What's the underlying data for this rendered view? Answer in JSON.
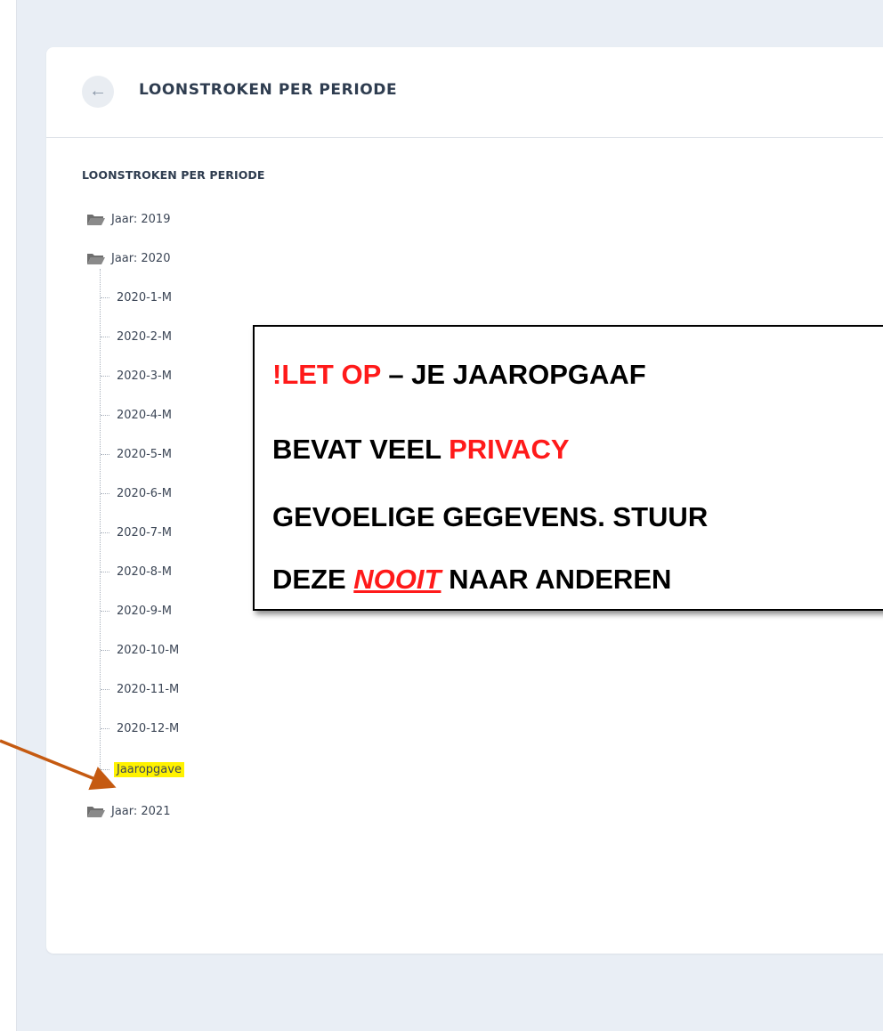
{
  "header": {
    "back_icon": "arrow-left-icon",
    "title": "LOONSTROKEN PER PERIODE"
  },
  "tree": {
    "label": "LOONSTROKEN PER PERIODE",
    "folders": [
      {
        "label": "Jaar: 2019",
        "icon": "folder-open-icon"
      },
      {
        "label": "Jaar: 2020",
        "icon": "folder-open-icon"
      },
      {
        "label": "Jaar: 2021",
        "icon": "folder-open-icon"
      }
    ],
    "items_2020": [
      "2020-1-M",
      "2020-2-M",
      "2020-3-M",
      "2020-4-M",
      "2020-5-M",
      "2020-6-M",
      "2020-7-M",
      "2020-8-M",
      "2020-9-M",
      "2020-10-M",
      "2020-11-M",
      "2020-12-M",
      "Jaaropgave"
    ],
    "highlight_color": "#fff200"
  },
  "notice": {
    "line1_red": "!LET OP",
    "line1_rest": " – JE JAAROPGAAF",
    "line2_start": "BEVAT VEEL ",
    "line2_red": "PRIVACY",
    "line3": "GEVOELIGE GEGEVENS. STUUR",
    "line4_start": "DEZE ",
    "line4_red": "NOOIT",
    "line4_rest": " NAAR ANDEREN",
    "accent_color": "#ff1a1a"
  },
  "annotation": {
    "arrow_color": "#c55a11"
  }
}
